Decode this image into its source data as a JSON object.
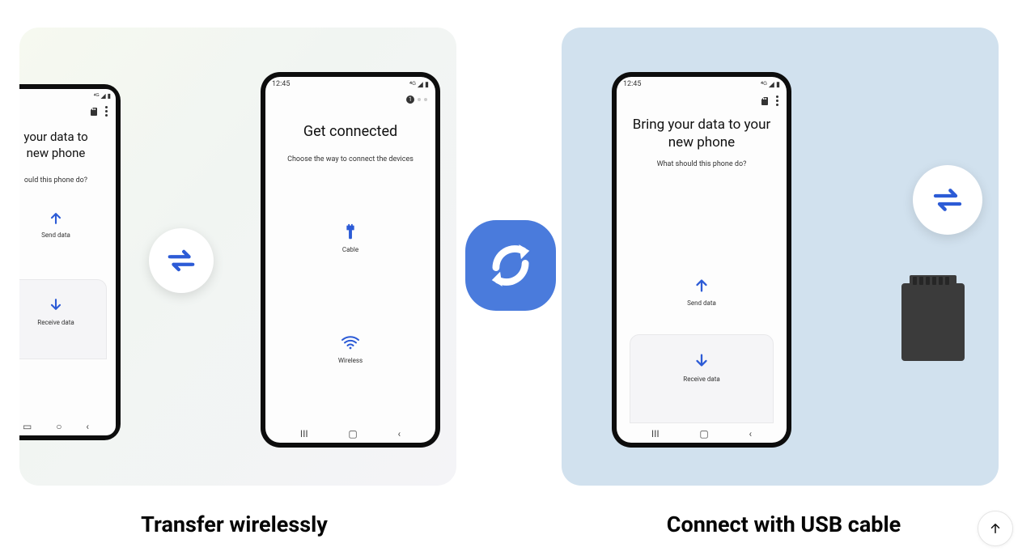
{
  "left_panel": {
    "phone1": {
      "status_icons": "⁴ᴳ ◢ ▮",
      "header_icon": "sd-icon",
      "title_partial": "your data to\nnew phone",
      "sub_partial": "ould this phone do?",
      "send_label": "Send data",
      "receive_label": "Receive data"
    },
    "phone2": {
      "time": "12:45",
      "status_icons": "⁴ᴳ ◢ ▮",
      "step_active": "1",
      "title": "Get connected",
      "subtitle": "Choose the way to connect the devices",
      "option_cable": "Cable",
      "option_wireless": "Wireless"
    },
    "caption": "Transfer wirelessly"
  },
  "right_panel": {
    "phone3": {
      "time": "12:45",
      "status_icons": "⁴ᴳ ◢ ▮",
      "title": "Bring your data to your new phone",
      "subtitle": "What should this phone do?",
      "send_label": "Send data",
      "receive_label": "Receive data"
    },
    "caption": "Connect with USB cable"
  },
  "colors": {
    "accent": "#2c5bd6",
    "logo_bg": "#4a7bdc"
  }
}
